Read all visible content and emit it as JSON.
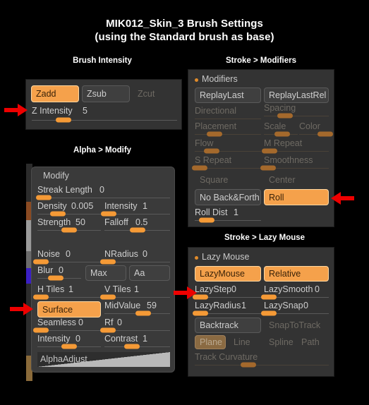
{
  "title": {
    "line1": "MIK012_Skin_3 Brush Settings",
    "line2": "(using the Standard brush as base)"
  },
  "colors": {
    "accent_on": "#f5a14b",
    "knob": "#f59a36",
    "knob_off": "#a4692c",
    "panel_bg": "#3a3a3a",
    "arrow_red": "#ee0000",
    "text": "#cfcfcf",
    "text_off": "#6e6a63"
  },
  "sections": {
    "brush_intensity": {
      "title": "Brush Intensity",
      "buttons": [
        {
          "label": "Zadd",
          "state": "on"
        },
        {
          "label": "Zsub",
          "state": "normal"
        },
        {
          "label": "Zcut",
          "state": "ghost"
        }
      ],
      "sliders": [
        {
          "label": "Z Intensity",
          "value": "5",
          "fill": 0.22,
          "state": "on"
        }
      ]
    },
    "stroke_modifiers": {
      "title": "Stroke > Modifiers",
      "header": "Modifiers",
      "buttons_row1": [
        {
          "label": "ReplayLast",
          "state": "normal"
        },
        {
          "label": "ReplayLastRel",
          "state": "normal"
        }
      ],
      "sliders": [
        {
          "label": "Directional",
          "value": "",
          "fill": 0.0,
          "state": "off",
          "col": 0,
          "row": 0,
          "knob": false
        },
        {
          "label": "Spacing",
          "value": "",
          "fill": 0.33,
          "state": "off",
          "col": 1,
          "row": 0,
          "knob": true
        },
        {
          "label": "Placement",
          "value": "",
          "fill": 0.3,
          "state": "off",
          "col": 0,
          "row": 1,
          "knob": true
        },
        {
          "label": "Scale",
          "value": "",
          "fill": 0.28,
          "state": "off",
          "col": 1,
          "row": 1,
          "knob": true
        },
        {
          "label": "Color",
          "value": "",
          "fill": 0.92,
          "state": "off",
          "col": 2,
          "row": 1,
          "knob": true
        },
        {
          "label": "Flow",
          "value": "",
          "fill": 0.23,
          "state": "off",
          "col": 0,
          "row": 2,
          "knob": true
        },
        {
          "label": "M Repeat",
          "value": "",
          "fill": 0.06,
          "state": "off",
          "col": 1,
          "row": 2,
          "knob": true
        },
        {
          "label": "S Repeat",
          "value": "",
          "fill": 0.05,
          "state": "off",
          "col": 0,
          "row": 3,
          "knob": true
        },
        {
          "label": "Smoothness",
          "value": "",
          "fill": 0.05,
          "state": "off",
          "col": 1,
          "row": 3,
          "knob": true
        }
      ],
      "ghost_row": [
        {
          "label": "Square",
          "state": "ghost"
        },
        {
          "label": "Center",
          "state": "ghost"
        }
      ],
      "buttons_row2": [
        {
          "label": "No Back&Forth",
          "state": "normal"
        },
        {
          "label": "Roll",
          "state": "on"
        }
      ],
      "bottom_slider": {
        "label": "Roll Dist",
        "value": "1",
        "fill": 0.18,
        "state": "on"
      }
    },
    "alpha_modify": {
      "title": "Alpha > Modify",
      "header": "Modify",
      "sliders": [
        {
          "label": "Streak Length",
          "value": "0",
          "fill": 0.04,
          "state": "on",
          "wide": true
        },
        {
          "label": "Density",
          "value": "0.005",
          "fill": 0.32,
          "state": "on",
          "col": 0
        },
        {
          "label": "Intensity",
          "value": "1",
          "fill": 0.05,
          "state": "on",
          "col": 1
        },
        {
          "label": "Strength",
          "value": "50",
          "fill": 0.5,
          "state": "on",
          "col": 0
        },
        {
          "label": "Falloff",
          "value": "0.5",
          "fill": 0.5,
          "state": "on",
          "col": 1
        },
        {
          "label": "Noise",
          "value": "0",
          "fill": 0.04,
          "state": "on",
          "col": 0
        },
        {
          "label": "NRadius",
          "value": "0",
          "fill": 0.04,
          "state": "on",
          "col": 1
        },
        {
          "label": "Blur",
          "value": "0",
          "fill": 0.42,
          "state": "on",
          "col": 0,
          "narrow": true
        },
        {
          "label": "H Tiles",
          "value": "1",
          "fill": 0.04,
          "state": "on",
          "col": 0
        },
        {
          "label": "V Tiles",
          "value": "1",
          "fill": 0.04,
          "state": "on",
          "col": 1
        },
        {
          "label": "MidValue",
          "value": "59",
          "fill": 0.59,
          "state": "on",
          "col": 1
        },
        {
          "label": "Seamless",
          "value": "0",
          "fill": 0.04,
          "state": "on",
          "col": 0
        },
        {
          "label": "Rf",
          "value": "0",
          "fill": 0.04,
          "state": "on",
          "col": 1
        },
        {
          "label": "Intensity",
          "value": "0",
          "fill": 0.5,
          "state": "on",
          "col": 0
        },
        {
          "label": "Contrast",
          "value": "1",
          "fill": 0.42,
          "state": "on",
          "col": 1
        }
      ],
      "buttons": [
        {
          "label": "Max",
          "state": "normal"
        },
        {
          "label": "Aa",
          "state": "normal"
        },
        {
          "label": "Surface",
          "state": "on"
        }
      ],
      "alpha_adjust_label": "AlphaAdjust"
    },
    "stroke_lazy_mouse": {
      "title": "Stroke > Lazy Mouse",
      "header": "Lazy Mouse",
      "buttons_row1": [
        {
          "label": "LazyMouse",
          "state": "on"
        },
        {
          "label": "Relative",
          "state": "on"
        }
      ],
      "sliders": [
        {
          "label": "LazyStep",
          "value": "0",
          "fill": 0.05,
          "state": "on",
          "col": 0
        },
        {
          "label": "LazySmooth",
          "value": "0",
          "fill": 0.05,
          "state": "on",
          "col": 1
        },
        {
          "label": "LazyRadius",
          "value": "1",
          "fill": 0.05,
          "state": "on",
          "col": 0
        },
        {
          "label": "LazySnap",
          "value": "0",
          "fill": 0.05,
          "state": "on",
          "col": 1
        }
      ],
      "buttons_row2": [
        {
          "label": "Backtrack",
          "state": "normal"
        },
        {
          "label": "SnapToTrack",
          "state": "ghost"
        }
      ],
      "mode_row": [
        {
          "label": "Plane",
          "state": "dim"
        },
        {
          "label": "Line",
          "state": "ghost"
        },
        {
          "label": "Spline",
          "state": "ghost"
        },
        {
          "label": "Path",
          "state": "ghost"
        }
      ],
      "bottom_slider": {
        "label": "Track Curvature",
        "value": "",
        "fill": 0.4,
        "state": "off"
      }
    }
  },
  "annotations": {
    "arrows": [
      {
        "name": "arrow-z-intensity",
        "direction": "right"
      },
      {
        "name": "arrow-surface",
        "direction": "right"
      },
      {
        "name": "arrow-lazystep",
        "direction": "right"
      },
      {
        "name": "arrow-roll",
        "direction": "left"
      }
    ]
  }
}
